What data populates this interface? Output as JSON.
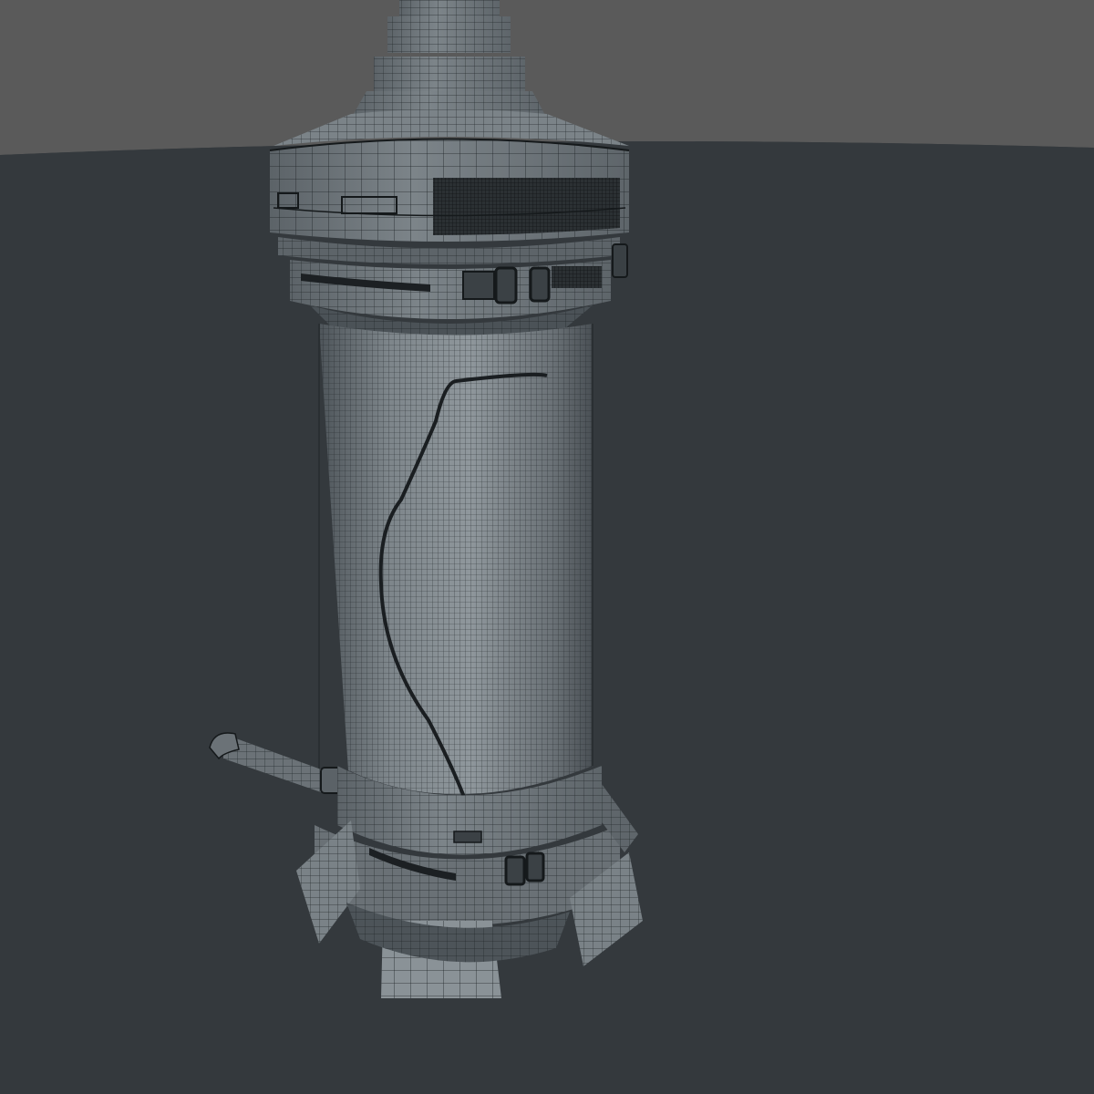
{
  "scene": {
    "subject": "sci-fi-cylinder-tower-wireframe",
    "colors": {
      "background_far": "#5a5a5a",
      "floor": "#34393d",
      "mesh_base": "#6c7378",
      "mesh_light": "#8d959b",
      "mesh_dark": "#3c4348",
      "wire": "#1e2326",
      "panel_dark": "#25292c"
    }
  }
}
